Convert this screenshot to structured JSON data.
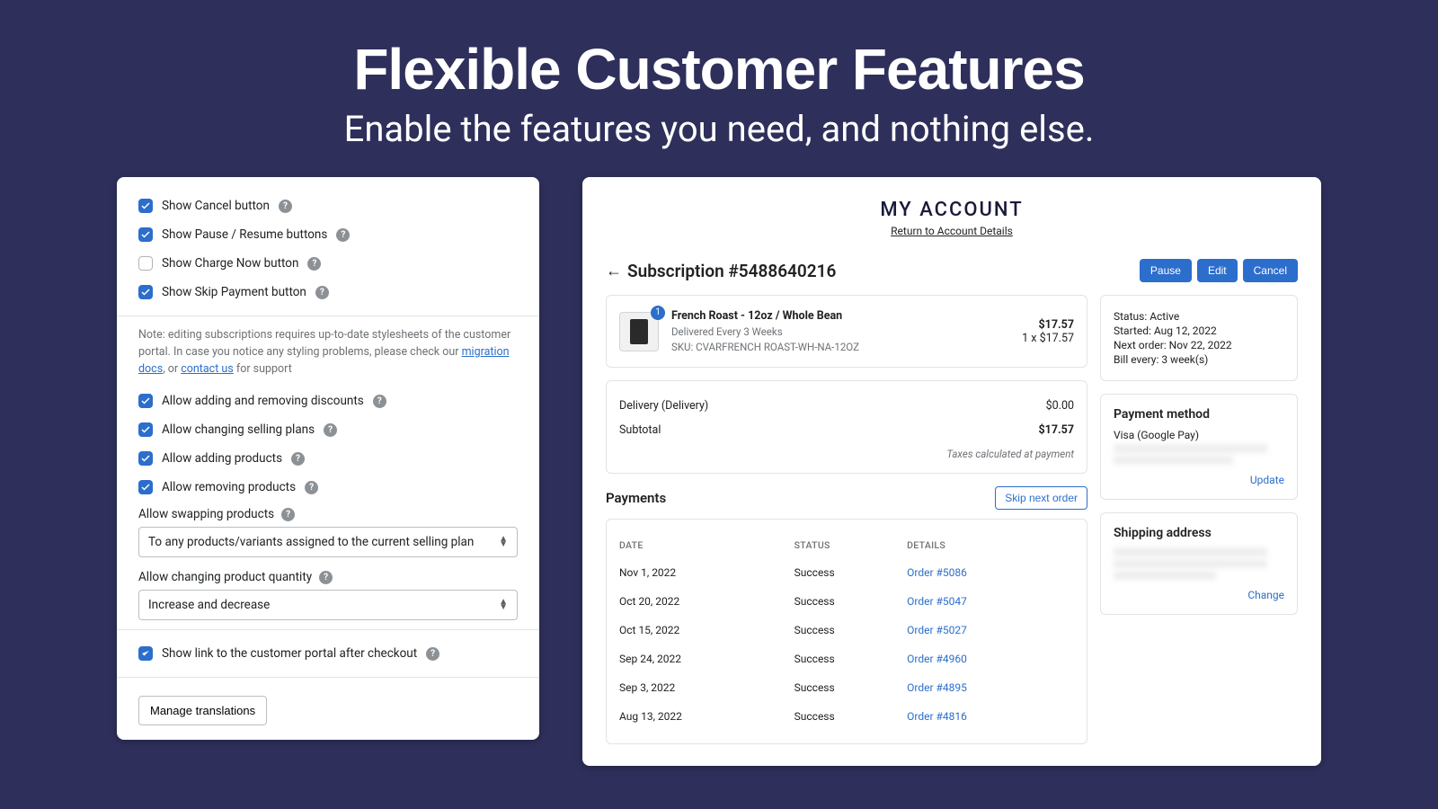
{
  "hero": {
    "title": "Flexible Customer Features",
    "subtitle": "Enable the features you need, and nothing else."
  },
  "settings": {
    "opts": [
      {
        "label": "Show Cancel button",
        "checked": true
      },
      {
        "label": "Show Pause / Resume buttons",
        "checked": true
      },
      {
        "label": "Show Charge Now button",
        "checked": false
      },
      {
        "label": "Show Skip Payment button",
        "checked": true
      }
    ],
    "note_prefix": "Note: editing subscriptions requires up-to-date stylesheets of the customer portal. In case you notice any styling problems, please check our ",
    "note_link1": "migration docs",
    "note_mid": ", or ",
    "note_link2": "contact us",
    "note_suffix": " for support",
    "opts2": [
      {
        "label": "Allow adding and removing discounts",
        "checked": true
      },
      {
        "label": "Allow changing selling plans",
        "checked": true
      },
      {
        "label": "Allow adding products",
        "checked": true
      },
      {
        "label": "Allow removing products",
        "checked": true
      }
    ],
    "swap_label": "Allow swapping products",
    "swap_value": "To any products/variants assigned to the current selling plan",
    "qty_label": "Allow changing product quantity",
    "qty_value": "Increase and decrease",
    "opt3": {
      "label": "Show link to the customer portal after checkout",
      "checked": true
    },
    "manage_btn": "Manage translations"
  },
  "account": {
    "title": "MY ACCOUNT",
    "return": "Return to Account Details",
    "sub_id": "Subscription #5488640216",
    "btns": [
      "Pause",
      "Edit",
      "Cancel"
    ],
    "product": {
      "qty": "1",
      "name": "French Roast - 12oz / Whole Bean",
      "delivery": "Delivered Every 3 Weeks",
      "sku": "SKU: CVARFRENCH ROAST-WH-NA-12OZ",
      "price": "$17.57",
      "breakdown": "1 x $17.57"
    },
    "totals": {
      "delivery_label": "Delivery (Delivery)",
      "delivery_val": "$0.00",
      "subtotal_label": "Subtotal",
      "subtotal_val": "$17.57",
      "tax_note": "Taxes calculated at payment"
    },
    "payments": {
      "title": "Payments",
      "skip": "Skip next order",
      "headers": [
        "DATE",
        "STATUS",
        "DETAILS"
      ],
      "rows": [
        {
          "date": "Nov 1, 2022",
          "status": "Success",
          "order": "Order #5086"
        },
        {
          "date": "Oct 20, 2022",
          "status": "Success",
          "order": "Order #5047"
        },
        {
          "date": "Oct 15, 2022",
          "status": "Success",
          "order": "Order #5027"
        },
        {
          "date": "Sep 24, 2022",
          "status": "Success",
          "order": "Order #4960"
        },
        {
          "date": "Sep 3, 2022",
          "status": "Success",
          "order": "Order #4895"
        },
        {
          "date": "Aug 13, 2022",
          "status": "Success",
          "order": "Order #4816"
        }
      ]
    },
    "status": {
      "s1": "Status: Active",
      "s2": "Started: Aug 12, 2022",
      "s3": "Next order: Nov 22, 2022",
      "s4": "Bill every: 3 week(s)"
    },
    "payment_method": {
      "title": "Payment method",
      "value": "Visa (Google Pay)",
      "update": "Update"
    },
    "shipping": {
      "title": "Shipping address",
      "change": "Change"
    }
  }
}
